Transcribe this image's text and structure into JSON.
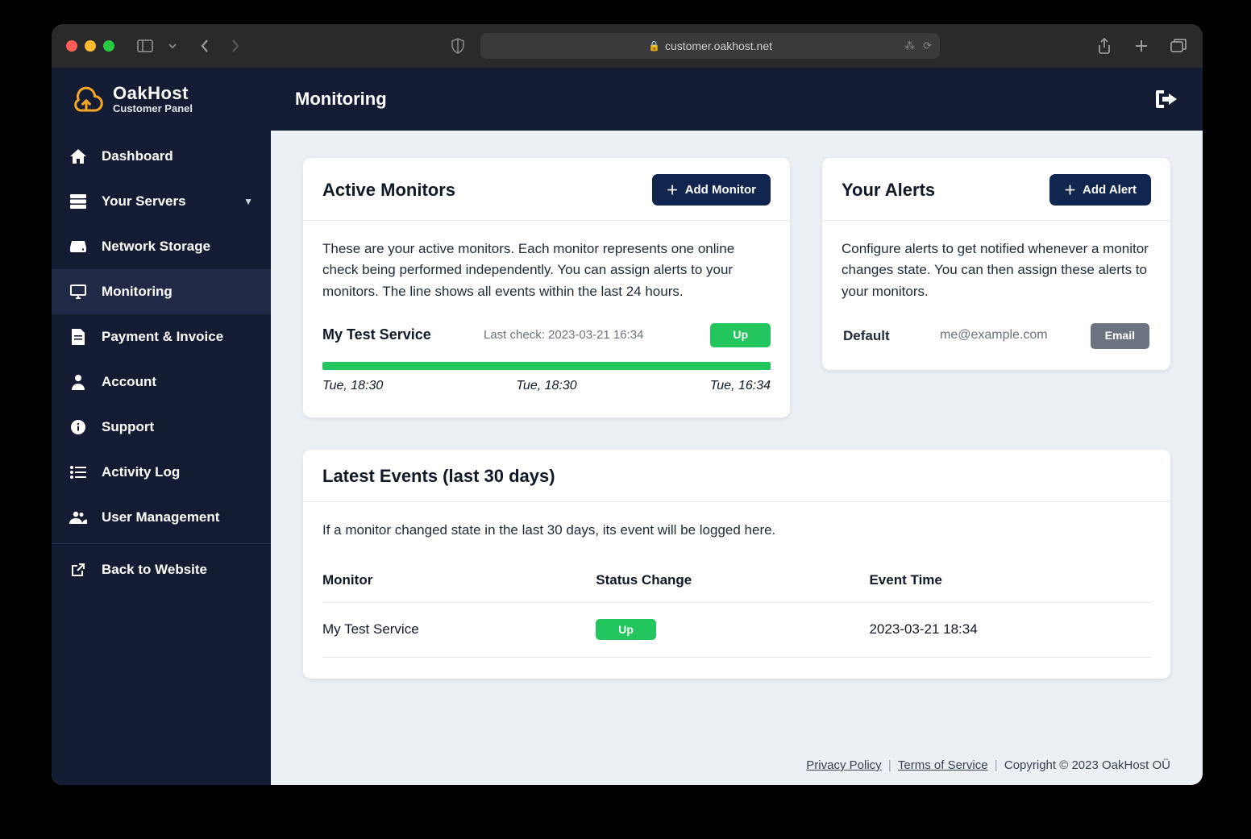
{
  "browser": {
    "url": "customer.oakhost.net"
  },
  "brand": {
    "name": "OakHost",
    "subtitle": "Customer Panel"
  },
  "sidebar": {
    "items": [
      {
        "label": "Dashboard"
      },
      {
        "label": "Your Servers"
      },
      {
        "label": "Network Storage"
      },
      {
        "label": "Monitoring"
      },
      {
        "label": "Payment & Invoice"
      },
      {
        "label": "Account"
      },
      {
        "label": "Support"
      },
      {
        "label": "Activity Log"
      },
      {
        "label": "User Management"
      },
      {
        "label": "Back to Website"
      }
    ]
  },
  "page": {
    "title": "Monitoring"
  },
  "monitors": {
    "heading": "Active Monitors",
    "add_label": "Add Monitor",
    "description": "These are your active monitors. Each monitor represents one online check being performed independently. You can assign alerts to your monitors. The line shows all events within the last 24 hours.",
    "item": {
      "name": "My Test Service",
      "last_check": "Last check: 2023-03-21 16:34",
      "status": "Up",
      "t0": "Tue, 18:30",
      "t1": "Tue, 18:30",
      "t2": "Tue, 16:34"
    }
  },
  "alerts": {
    "heading": "Your Alerts",
    "add_label": "Add Alert",
    "description": "Configure alerts to get notified whenever a monitor changes state. You can then assign these alerts to your monitors.",
    "item": {
      "name": "Default",
      "target": "me@example.com",
      "type": "Email"
    }
  },
  "events": {
    "heading": "Latest Events (last 30 days)",
    "description": "If a monitor changed state in the last 30 days, its event will be logged here.",
    "columns": {
      "monitor": "Monitor",
      "status": "Status Change",
      "time": "Event Time"
    },
    "row": {
      "monitor": "My Test Service",
      "status": "Up",
      "time": "2023-03-21 18:34"
    }
  },
  "footer": {
    "privacy": "Privacy Policy",
    "terms": "Terms of Service",
    "copyright": "Copyright © 2023 OakHost OÜ"
  }
}
